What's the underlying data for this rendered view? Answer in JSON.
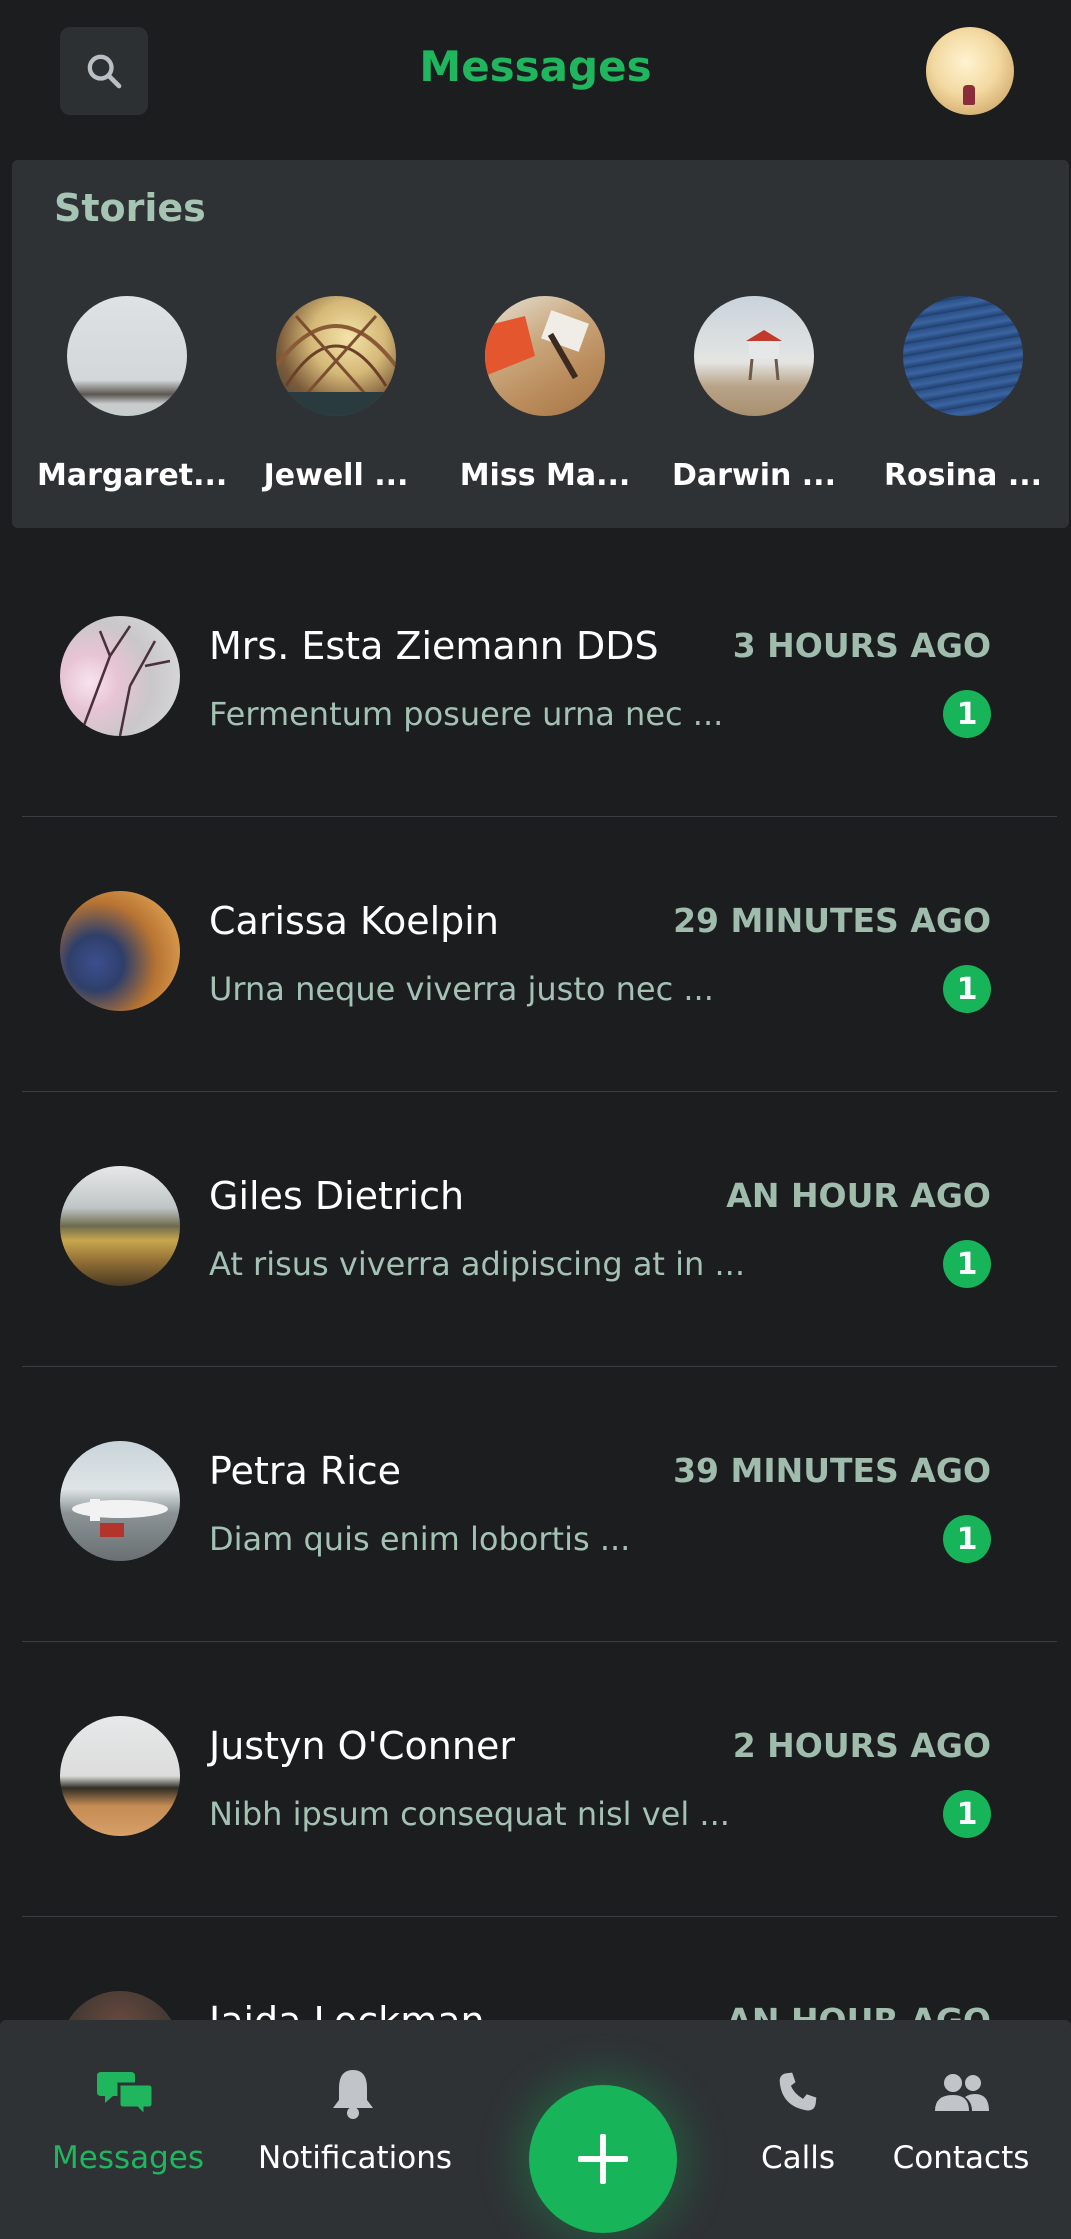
{
  "header": {
    "title": "Messages",
    "search_icon": "search-icon",
    "avatar": "user-avatar"
  },
  "stories": {
    "title": "Stories",
    "items": [
      {
        "name": "Margaret..."
      },
      {
        "name": "Jewell ..."
      },
      {
        "name": "Miss Ma..."
      },
      {
        "name": "Darwin ..."
      },
      {
        "name": "Rosina ..."
      }
    ]
  },
  "conversations": [
    {
      "name": "Mrs. Esta Ziemann DDS",
      "preview": "Fermentum posuere urna nec ...",
      "time": "3 HOURS AGO",
      "unread": "1"
    },
    {
      "name": "Carissa Koelpin",
      "preview": "Urna neque viverra justo nec ...",
      "time": "29 MINUTES AGO",
      "unread": "1"
    },
    {
      "name": "Giles Dietrich",
      "preview": "At risus viverra adipiscing at in ...",
      "time": "AN HOUR AGO",
      "unread": "1"
    },
    {
      "name": "Petra Rice",
      "preview": "Diam quis enim lobortis ...",
      "time": "39 MINUTES AGO",
      "unread": "1"
    },
    {
      "name": "Justyn O'Conner",
      "preview": "Nibh ipsum consequat nisl vel ...",
      "time": "2 HOURS AGO",
      "unread": "1"
    },
    {
      "name": "Jaida Lockman",
      "preview": "",
      "time": "AN HOUR AGO",
      "unread": ""
    }
  ],
  "bottom_nav": {
    "messages": "Messages",
    "notifications": "Notifications",
    "calls": "Calls",
    "contacts": "Contacts",
    "fab_icon": "plus-icon"
  },
  "colors": {
    "accent": "#1fb65e",
    "background": "#1b1d1f",
    "panel": "#2f3235",
    "muted_text": "#a3c2b4"
  }
}
